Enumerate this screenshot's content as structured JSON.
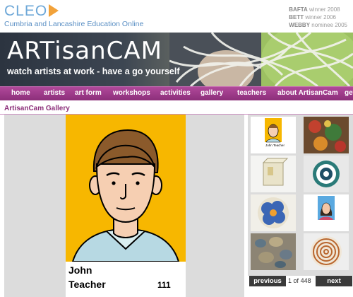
{
  "header": {
    "logo_text": "CLEO",
    "subtitle": "Cumbria and Lancashire Education Online",
    "awards": [
      {
        "name": "BAFTA",
        "text": "winner 2008"
      },
      {
        "name": "BETT",
        "text": "winner 2006"
      },
      {
        "name": "WEBBY",
        "text": "nominee 2005"
      }
    ]
  },
  "banner": {
    "title": "ARTisanCAM",
    "tagline": "watch artists at work - have a go yourself"
  },
  "nav": {
    "items": [
      "home",
      "artists",
      "art form",
      "workshops",
      "activities",
      "gallery",
      "teachers",
      "about ArtisanCam",
      "get"
    ]
  },
  "gallery": {
    "heading": "ArtisanCam Gallery",
    "caption_name": "John",
    "caption_role": "Teacher",
    "caption_number": "111",
    "thumb_caption": "John Teacher"
  },
  "pager": {
    "previous_label": "previous",
    "current": "1",
    "of_label": "of",
    "total": "448",
    "next_label": "next"
  },
  "colors": {
    "nav": "#8c2f7a",
    "accent_orange": "#f2a23a",
    "cleo_blue": "#6ea8d8",
    "portrait_yellow": "#f7b700"
  }
}
